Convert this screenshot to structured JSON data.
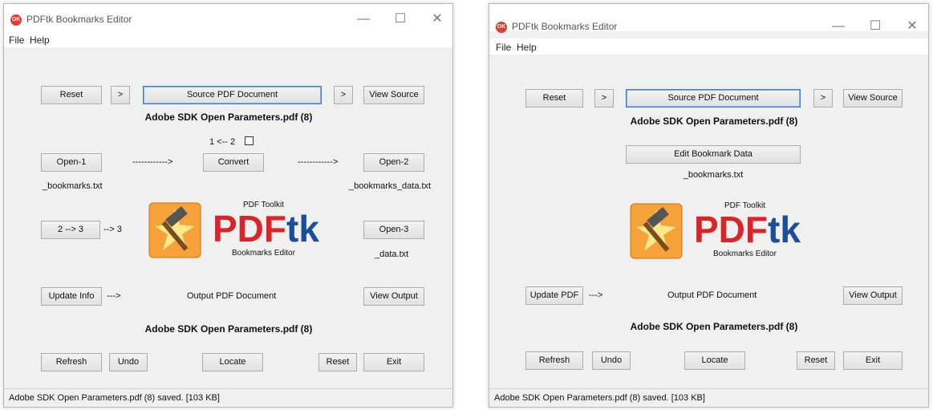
{
  "left": {
    "title": "PDFtk Bookmarks Editor",
    "menu": [
      "File",
      "Help"
    ],
    "buttons": {
      "reset_top": "Reset",
      "arrow1": ">",
      "source": "Source PDF Document",
      "arrow2": ">",
      "view_source": "View Source",
      "open1": "Open-1",
      "convert": "Convert",
      "open2": "Open-2",
      "two_three": "2 --> 3",
      "open3": "Open-3",
      "update_info": "Update Info",
      "view_output": "View Output",
      "refresh": "Refresh",
      "undo": "Undo",
      "locate": "Locate",
      "reset_bottom": "Reset",
      "exit": "Exit"
    },
    "labels": {
      "source_file": "Adobe SDK Open Parameters.pdf (8)",
      "direction": "1 <-- 2",
      "arrow_left": "------------>",
      "arrow_right": "------------>",
      "file1": "_bookmarks.txt",
      "file2": "_bookmarks_data.txt",
      "to3": "--> 3",
      "file3": "_data.txt",
      "update_arrow": "--->",
      "output_label": "Output PDF Document",
      "output_file": "Adobe SDK Open Parameters.pdf (8)"
    },
    "logo": {
      "small": "PDF Toolkit",
      "pdf": "PDF",
      "tk": "tk",
      "sub": "Bookmarks Editor"
    },
    "status": "Adobe SDK Open Parameters.pdf (8) saved. [103 KB]"
  },
  "right": {
    "title": "PDFtk Bookmarks Editor",
    "menu": [
      "File",
      "Help"
    ],
    "buttons": {
      "reset_top": "Reset",
      "arrow1": ">",
      "source": "Source PDF Document",
      "arrow2": ">",
      "view_source": "View Source",
      "edit": "Edit Bookmark Data",
      "update_pdf": "Update PDF",
      "view_output": "View Output",
      "refresh": "Refresh",
      "undo": "Undo",
      "locate": "Locate",
      "reset_bottom": "Reset",
      "exit": "Exit"
    },
    "labels": {
      "source_file": "Adobe SDK Open Parameters.pdf (8)",
      "file1": "_bookmarks.txt",
      "update_arrow": "--->",
      "output_label": "Output PDF Document",
      "output_file": "Adobe SDK Open Parameters.pdf (8)"
    },
    "logo": {
      "small": "PDF Toolkit",
      "pdf": "PDF",
      "tk": "tk",
      "sub": "Bookmarks Editor"
    },
    "status": "Adobe SDK Open Parameters.pdf (8) saved. [103 KB]"
  },
  "colors": {
    "pdf": "#d7252a",
    "tk": "#1a4f9e",
    "accent": "#3a7bd5",
    "window_bg": "#f0f0f0"
  }
}
